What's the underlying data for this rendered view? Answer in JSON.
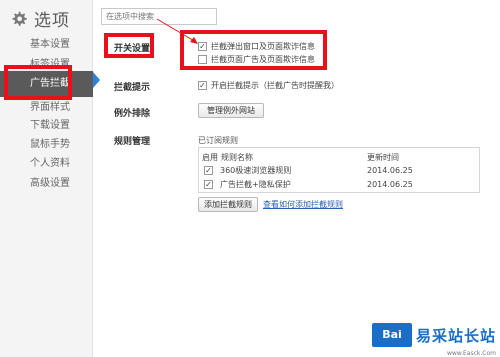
{
  "app": {
    "title": "选项",
    "search_placeholder": "在选项中搜索"
  },
  "sidebar": {
    "items": [
      {
        "label": "基本设置"
      },
      {
        "label": "标签设置"
      },
      {
        "label": "广告拦截"
      },
      {
        "label": "界面样式"
      },
      {
        "label": "下载设置"
      },
      {
        "label": "鼠标手势"
      },
      {
        "label": "个人资料"
      },
      {
        "label": "高级设置"
      }
    ],
    "active": "广告拦截"
  },
  "switch_settings": {
    "heading": "开关设置",
    "options": [
      {
        "label": "拦截弹出窗口及页面欺诈信息",
        "checked": true
      },
      {
        "label": "拦截页面广告及页面欺诈信息",
        "checked": false
      }
    ]
  },
  "block_prompt": {
    "heading": "拦截提示",
    "option": {
      "label": "开启拦截提示（拦截广告时提醒我）",
      "checked": true
    }
  },
  "exceptions": {
    "heading": "例外排除",
    "button": "管理例外网站"
  },
  "rules": {
    "heading": "规则管理",
    "subscribed_label": "已订阅规则",
    "columns": [
      "启用",
      "规则名称",
      "更新时间"
    ],
    "rows": [
      {
        "enabled": true,
        "name": "360极速浏览器规则",
        "updated": "2014.06.25"
      },
      {
        "enabled": true,
        "name": "广告拦截+隐私保护",
        "updated": "2014.06.25"
      }
    ],
    "add_button": "添加拦截规则",
    "link": "查看如何添加拦截规则"
  },
  "watermark": {
    "logo": "Bai",
    "text": "易采站长站",
    "url": "www.Easck.Com"
  },
  "colors": {
    "highlight": "#e8101a",
    "active_nav": "#5a5a5a",
    "accent": "#2e7fd8"
  }
}
